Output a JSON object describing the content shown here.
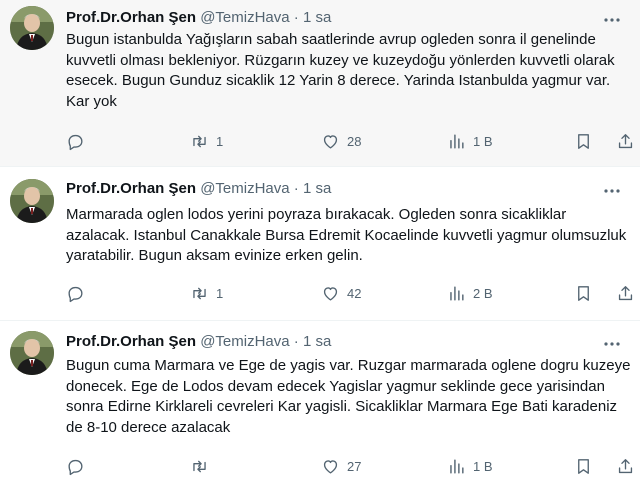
{
  "colors": {
    "text": "#0f1419",
    "muted": "#536471",
    "highlight_bg": "#f7f7f7",
    "divider": "#eff3f4"
  },
  "tweets": [
    {
      "author": "Prof.Dr.Orhan Şen",
      "handle": "@TemizHava",
      "sep": "·",
      "time": "1 sa",
      "text": "Bugun istanbulda Yağışların sabah  saatlerinde avrup ogleden sonra  il genelinde kuvvetli olması bekleniyor. Rüzgarın kuzey ve kuzeydoğu yönlerden kuvvetli olarak esecek. Bugun Gunduz sicaklik 12 Yarin 8 derece. Yarinda Istanbulda yagmur var. Kar yok",
      "reply_count": "",
      "retweet_count": "1",
      "like_count": "28",
      "view_count": "1 B"
    },
    {
      "author": "Prof.Dr.Orhan Şen",
      "handle": "@TemizHava",
      "sep": "·",
      "time": "1 sa",
      "text": "Marmarada oglen lodos yerini poyraza bırakacak. Ogleden sonra sicakliklar azalacak. Istanbul Canakkale Bursa Edremit Kocaelinde kuvvetli yagmur olumsuzluk yaratabilir. Bugun aksam evinize erken gelin.",
      "reply_count": "",
      "retweet_count": "1",
      "like_count": "42",
      "view_count": "2 B"
    },
    {
      "author": "Prof.Dr.Orhan Şen",
      "handle": "@TemizHava",
      "sep": "·",
      "time": "1 sa",
      "text": "Bugun cuma Marmara ve Ege de yagis var. Ruzgar marmarada oglene dogru kuzeye donecek. Ege de Lodos devam edecek Yagislar yagmur seklinde gece yarisindan sonra Edirne Kirklareli cevreleri Kar yagisli.  Sicakliklar Marmara Ege Bati karadeniz de 8-10 derece azalacak",
      "reply_count": "",
      "retweet_count": "",
      "like_count": "27",
      "view_count": "1 B"
    }
  ],
  "icons": {
    "reply": "speech-bubble-icon",
    "retweet": "retweet-arrows-icon",
    "like": "heart-icon",
    "views": "bar-chart-icon",
    "bookmark": "bookmark-icon",
    "share": "share-upload-icon",
    "more": "more-dots-icon"
  }
}
